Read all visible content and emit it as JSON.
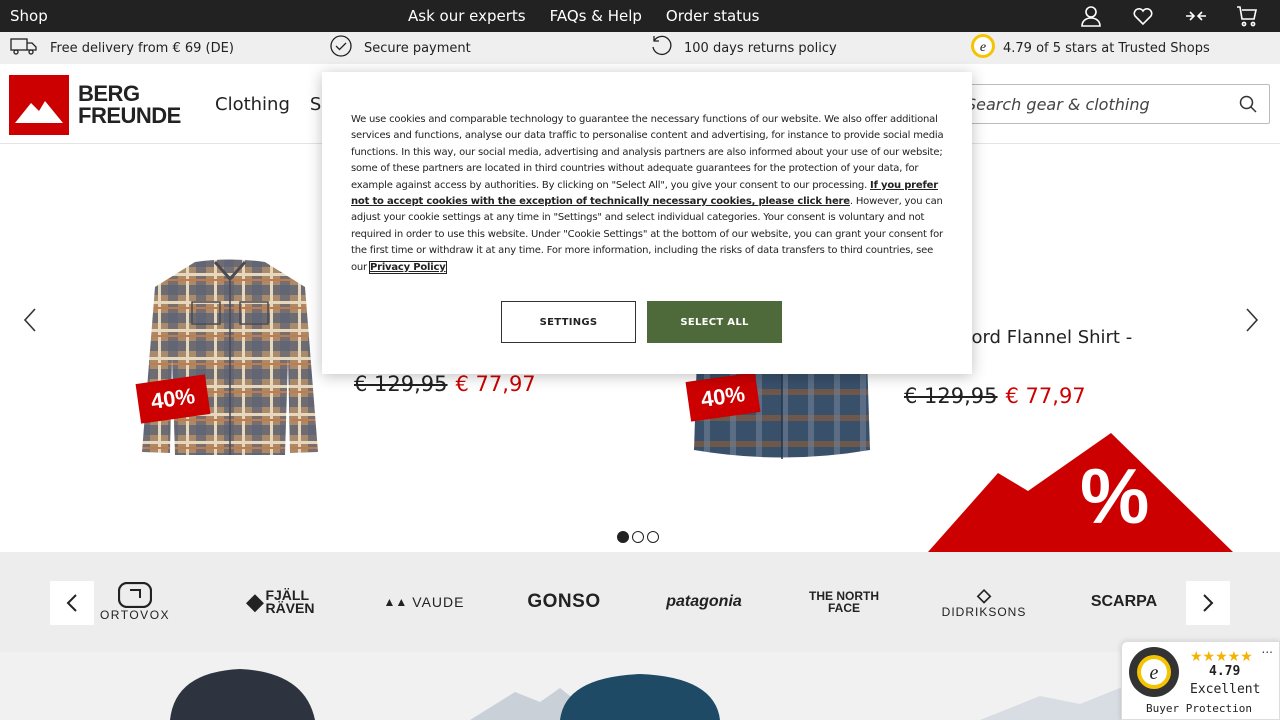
{
  "topbar": {
    "shop_label": "Shop",
    "links": [
      "Ask our experts",
      "FAQs & Help",
      "Order status"
    ],
    "icons": [
      "user-icon",
      "heart-icon",
      "compare-icon",
      "cart-icon"
    ]
  },
  "usp": {
    "delivery": "Free delivery from € 69 (DE)",
    "payment": "Secure payment",
    "returns": "100 days returns policy",
    "rating": "4.79 of 5 stars at Trusted Shops"
  },
  "header": {
    "logo_line1": "BERG",
    "logo_line2": "FREUNDE",
    "nav": [
      "Clothing",
      "Sh"
    ],
    "search_placeholder": "Search gear & clothing"
  },
  "hero": {
    "products": [
      {
        "badge": "40%",
        "old_price": "€ 129,95",
        "new_price": "€ 77,97"
      },
      {
        "badge": "40%",
        "title": "s Fjord Flannel Shirt -",
        "old_price": "€ 129,95",
        "new_price": "€ 77,97"
      }
    ],
    "sale_symbol": "%",
    "dots": 3,
    "active_dot": 0
  },
  "brands": [
    "ORTOVOX",
    "FJÄLL RÄVEN",
    "VAUDE",
    "GONSO",
    "patagonia",
    "THE NORTH FACE",
    "DIDRIKSONS",
    "SCARPA"
  ],
  "cookie": {
    "text_before": "We use cookies and comparable technology to guarantee the necessary functions of our website. We also offer additional services and functions, analyse our data traffic to personalise content and advertising, for instance to provide social media functions. In this way, our social media, advertising and analysis partners are also informed about your use of our website; some of these partners are located in third countries without adequate guarantees for the protection of your data, for example against access by authorities. By clicking on \"Select All\", you give your consent to our processing.",
    "link_text": "If you prefer not to accept cookies with the exception of technically necessary cookies, please click here",
    "text_after": ". However, you can adjust your cookie settings at any time in \"Settings\" and select individual categories. Your consent is voluntary and not required in order to use this website. Under \"Cookie Settings\" at the bottom of our website, you can grant your consent for the first time or withdraw it at any time. For more information, including the risks of data transfers to third countries, see our",
    "privacy_link": "Privacy Policy",
    "settings_label": "SETTINGS",
    "select_all_label": "SELECT ALL"
  },
  "trusted_badge": {
    "stars": "★★★★★",
    "score": "4.79",
    "label": "Excellent",
    "protection": "Buyer Protection",
    "more": "..."
  },
  "colors": {
    "brand_red": "#cc0000",
    "accept_green": "#4e6a3a",
    "topbar": "#222222"
  }
}
